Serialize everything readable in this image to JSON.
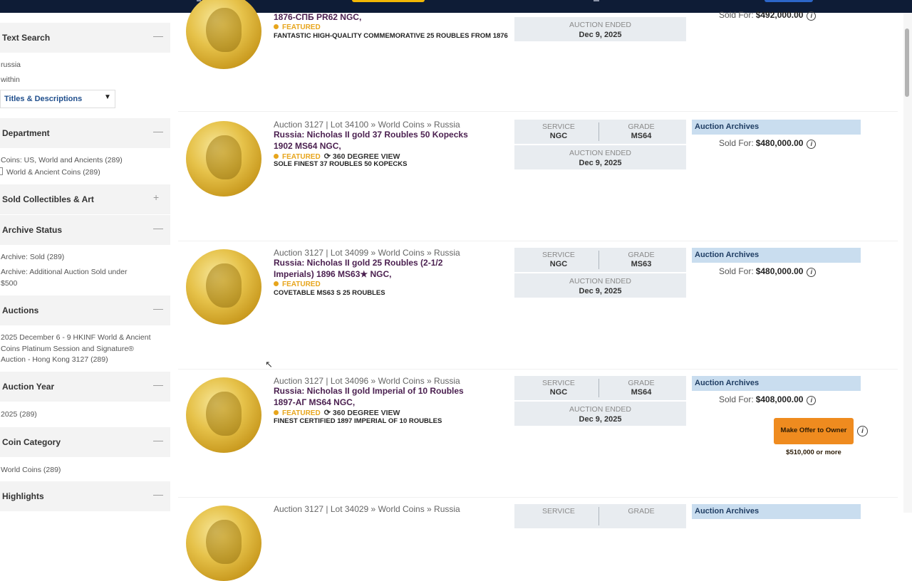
{
  "sidebar": {
    "text_search": {
      "title": "Text Search",
      "toggle": "—",
      "query": "russia",
      "within_label": "within",
      "select_value": "Titles & Descriptions",
      "select_caret": "▼"
    },
    "department": {
      "title": "Department",
      "toggle": "—",
      "items": [
        "Coins: US, World and Ancients (289)",
        "World & Ancient Coins (289)"
      ]
    },
    "sold_collectibles": {
      "title": "Sold Collectibles & Art",
      "toggle": "+"
    },
    "archive_status": {
      "title": "Archive Status",
      "toggle": "—",
      "items": [
        "Archive: Sold (289)",
        "Archive: Additional Auction Sold under $500"
      ]
    },
    "auctions": {
      "title": "Auctions",
      "toggle": "—",
      "items": [
        "2025 December 6 - 9 HKINF World & Ancient Coins Platinum Session and Signature® Auction - Hong Kong 3127 (289)"
      ]
    },
    "auction_year": {
      "title": "Auction Year",
      "toggle": "—",
      "items": [
        "2025 (289)"
      ]
    },
    "coin_category": {
      "title": "Coin Category",
      "toggle": "—",
      "items": [
        "World Coins (289)"
      ]
    },
    "highlights": {
      "title": "Highlights",
      "toggle": "—"
    }
  },
  "labels": {
    "service": "SERVICE",
    "grade": "GRADE",
    "auction_ended": "AUCTION ENDED",
    "auction_archives": "Auction Archives",
    "sold_for": "Sold For:",
    "featured": "FEATURED",
    "degree_view": "360 DEGREE VIEW",
    "info": "i",
    "rotate": "⟳",
    "cursor": "↖"
  },
  "results": [
    {
      "title": "1876-СПБ PR62 NGC,",
      "desc": "FANTASTIC HIGH-QUALITY COMMEMORATIVE 25 ROUBLES FROM 1876",
      "ended": "Dec 9, 2025",
      "sold": "$492,000.00"
    },
    {
      "crumb": "Auction 3127 | Lot 34100 » World Coins » Russia",
      "title": "Russia: Nicholas II gold 37 Roubles 50 Kopecks 1902 MS64 NGC,",
      "desc": "SOLE FINEST 37 ROUBLES 50 KOPECKS",
      "service": "NGC",
      "grade": "MS64",
      "ended": "Dec 9, 2025",
      "sold": "$480,000.00"
    },
    {
      "crumb": "Auction 3127 | Lot 34099 » World Coins » Russia",
      "title": "Russia: Nicholas II gold 25 Roubles (2-1/2 Imperials) 1896 MS63★ NGC,",
      "desc": "COVETABLE MS63 S 25 ROUBLES",
      "service": "NGC",
      "grade": "MS63",
      "ended": "Dec 9, 2025",
      "sold": "$480,000.00"
    },
    {
      "crumb": "Auction 3127 | Lot 34096 » World Coins » Russia",
      "title": "Russia: Nicholas II gold Imperial of 10 Roubles 1897-АГ MS64 NGC,",
      "desc": "FINEST CERTIFIED 1897 IMPERIAL OF 10 ROUBLES",
      "service": "NGC",
      "grade": "MS64",
      "ended": "Dec 9, 2025",
      "sold": "$408,000.00",
      "offer": [
        "Make Offer to Owner",
        "$510,000 or more"
      ]
    },
    {
      "crumb": "Auction 3127 | Lot 34029 » World Coins » Russia"
    }
  ]
}
